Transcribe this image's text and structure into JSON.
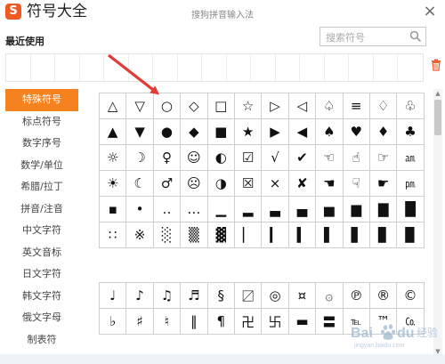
{
  "app": {
    "logo_glyph": "S",
    "title": "符号大全",
    "subtitle": "搜狗拼音输入法",
    "close_glyph": "×"
  },
  "recent": {
    "label": "最近使用",
    "slot_count": 17
  },
  "search": {
    "placeholder": "搜索符号",
    "value": ""
  },
  "sidebar": {
    "items": [
      {
        "label": "特殊符号",
        "active": true
      },
      {
        "label": "标点符号",
        "active": false
      },
      {
        "label": "数字序号",
        "active": false
      },
      {
        "label": "数学/单位",
        "active": false
      },
      {
        "label": "希腊/拉丁",
        "active": false
      },
      {
        "label": "拼音/注音",
        "active": false
      },
      {
        "label": "中文字符",
        "active": false
      },
      {
        "label": "英文音标",
        "active": false
      },
      {
        "label": "日文字符",
        "active": false
      },
      {
        "label": "韩文字符",
        "active": false
      },
      {
        "label": "俄文字母",
        "active": false
      },
      {
        "label": "制表符",
        "active": false
      }
    ]
  },
  "symbol_grid_1": [
    [
      "△",
      "▽",
      "○",
      "◇",
      "□",
      "☆",
      "▷",
      "◁",
      "♤",
      "≡",
      "♢",
      "♧"
    ],
    [
      "▲",
      "▼",
      "●",
      "◆",
      "■",
      "★",
      "▶",
      "◀",
      "♠",
      "♥",
      "♦",
      "♣"
    ],
    [
      "☼",
      "☽",
      "♀",
      "☺",
      "◐",
      "☑",
      "√",
      "✔",
      "☜",
      "☝",
      "☞",
      "㏂"
    ],
    [
      "☀",
      "☾",
      "♂",
      "☹",
      "◑",
      "☒",
      "×",
      "✘",
      "☚",
      "☟",
      "☛",
      "㏘"
    ],
    [
      "▪",
      "•",
      "‥",
      "…",
      "▁",
      "▂",
      "▃",
      "▄",
      "▅",
      "▆",
      "▇",
      "█"
    ],
    [
      "∷",
      "※",
      "░",
      "▒",
      "▓",
      "▏",
      "▎",
      "▍",
      "▌",
      "▋",
      "▊",
      "▉"
    ]
  ],
  "symbol_grid_2": [
    [
      "♩",
      "♪",
      "♫",
      "♬",
      "§",
      "〼",
      "◎",
      "¤",
      "۞",
      "℗",
      "®",
      "©"
    ],
    [
      "♭",
      "♯",
      "♮",
      "‖",
      "¶",
      "卍",
      "卐",
      "▬",
      "〓",
      "℡",
      "™",
      "㏇"
    ]
  ],
  "watermark": {
    "text": "Bai du 经验",
    "sub": "jingyan.baidu.com"
  },
  "colors": {
    "accent": "#f5821f",
    "logo": "#f05a22",
    "arrow": "#e53935",
    "grid_border": "#cfcfcf"
  },
  "icons": {
    "search": "search-icon",
    "trash": "trash-icon",
    "close": "close-icon"
  }
}
